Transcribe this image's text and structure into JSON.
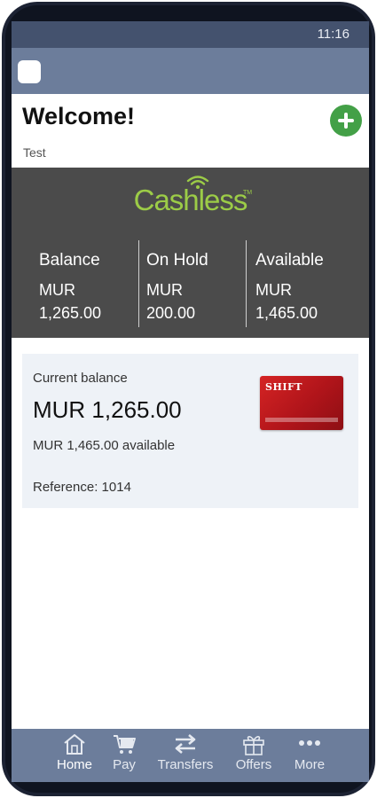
{
  "status_bar": {
    "time": "11:16"
  },
  "header": {
    "menu_icon": "menu-icon"
  },
  "welcome": {
    "title": "Welcome!",
    "subtitle": "Test",
    "add_icon": "plus-icon"
  },
  "summary": {
    "logo_text": "Cashless",
    "logo_tm": "TM",
    "columns": [
      {
        "label": "Balance",
        "currency": "MUR",
        "amount": "1,265.00"
      },
      {
        "label": "On Hold",
        "currency": "MUR",
        "amount": "200.00"
      },
      {
        "label": "Available",
        "currency": "MUR",
        "amount": "1,465.00"
      }
    ]
  },
  "card": {
    "label": "Current balance",
    "amount": "MUR 1,265.00",
    "available": "MUR 1,465.00 available",
    "reference": "Reference: 1014",
    "card_brand": "SHIFT"
  },
  "tabs": [
    {
      "label": "Home",
      "icon": "home-icon",
      "active": true
    },
    {
      "label": "Pay",
      "icon": "cart-icon",
      "active": false
    },
    {
      "label": "Transfers",
      "icon": "transfer-icon",
      "active": false
    },
    {
      "label": "Offers",
      "icon": "gift-icon",
      "active": false
    },
    {
      "label": "More",
      "icon": "more-icon",
      "active": false
    }
  ],
  "colors": {
    "app_bar": "#6c7d9b",
    "status_bar": "#44526e",
    "summary_bg": "#4b4b4b",
    "brand_green": "#9ccc47",
    "add_button": "#43a047",
    "card_bg": "#eef2f7"
  }
}
